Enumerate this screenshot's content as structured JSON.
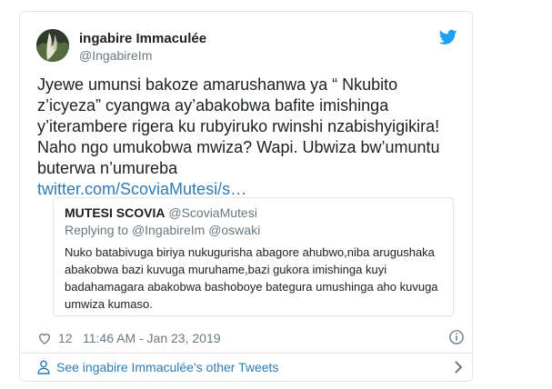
{
  "tweet": {
    "author_name": "ingabire Immaculée",
    "author_handle": "@IngabireIm",
    "text": "Jyewe umunsi bakoze amarushanwa ya “ Nkubito z’icyeza” cyangwa ay’abakobwa bafite imishinga y’iterambere rigera ku rubyiruko rwinshi nzabishyigikira! Naho ngo umukobwa mwiza? Wapi. Ubwiza bw’umuntu buterwa n’umureba",
    "link_text": "twitter.com/ScoviaMutesi/s…",
    "likes": "12",
    "timestamp": "11:46 AM - Jan 23, 2019"
  },
  "quoted": {
    "name": "MUTESI SCOVIA",
    "handle": "@ScoviaMutesi",
    "replying_prefix": "Replying to",
    "mention1": "@IngabireIm",
    "mention2": "@oswaki",
    "text": "Nuko batabivuga biriya nukugurisha abagore ahubwo,niba arugushaka abakobwa bazi kuvuga muruhame,bazi gukora imishinga kuyi badahamagara abakobwa bashoboye bategura umushinga aho kuvuga umwiza kumaso."
  },
  "footer": {
    "see_more": "See ingabire Immaculée's other Tweets"
  },
  "colors": {
    "link": "#2b7bb9",
    "twitter_blue": "#1da1f2",
    "secondary_text": "#697882"
  },
  "icons": [
    "twitter-bird-icon",
    "heart-icon",
    "info-icon",
    "person-icon",
    "chevron-right-icon"
  ]
}
